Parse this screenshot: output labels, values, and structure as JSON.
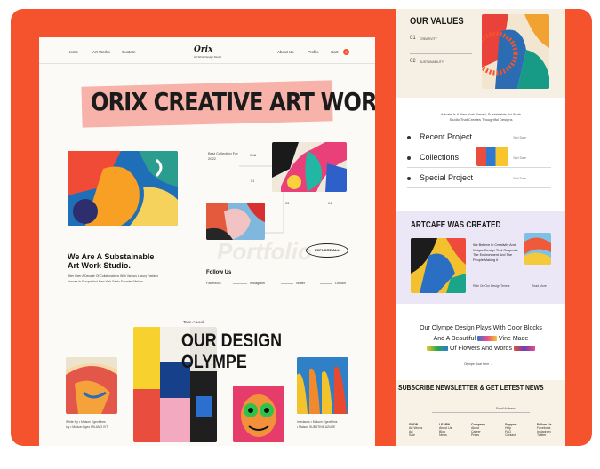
{
  "left_page": {
    "nav": {
      "left_links": [
        "Home",
        "Art Works",
        "Custom"
      ],
      "logo": "Orix",
      "logo_sub": "Art Work Design Studio",
      "right_links": [
        "About Us",
        "Profile",
        "Cart"
      ],
      "cart_count": "0"
    },
    "hero_title": "ORIX CREATIVE ART WORK",
    "collection": {
      "label": "Best Collection For 2022",
      "item_tags": [
        "Wall",
        "01",
        "03",
        "04"
      ]
    },
    "studio": {
      "heading_line1": "We Are A Substainable",
      "heading_line2": "Art Work Studio.",
      "body_line1": "After Over A Decade Of Collaborations With Various Luxury Fashion",
      "body_line2": "Houses In Europe And New York Santo Founded Melocu"
    },
    "explore_button": "EXPLORE ALL",
    "watermark": "Portfolio",
    "follow": {
      "title": "Follow Us",
      "links": [
        "Facebook",
        "Instagram",
        "Twitter",
        "Linkdin"
      ]
    },
    "design": {
      "take_a_look": "Take A Look",
      "title_line1": "OUR DESIGN",
      "title_line2": "OLYMPE",
      "caption_left_line1": "White Ivy • Maison Egeoffilms",
      "caption_left_line2": "Ivy • Maison Egeo MILANO IVT",
      "caption_right_line1": "Interlaces • Maison Egeoffilms",
      "caption_right_line2": "• Maison SUBSTINE AZURE"
    }
  },
  "right_page": {
    "values": {
      "title": "OUR VALUES",
      "items": [
        {
          "num": "01",
          "label": "CREATIVITY"
        },
        {
          "num": "02",
          "label": "SUSTAINABILITY"
        }
      ]
    },
    "intro_line1": "Artcafe Is A New York Based, Sustainable Art Work",
    "intro_line2": "Studio That Creates Thoughtful Designs",
    "list": [
      {
        "label": "Recent Project",
        "meta": "Sort Date"
      },
      {
        "label": "Collections",
        "meta": "Sort Date"
      },
      {
        "label": "Special Project",
        "meta": "Sort Date"
      }
    ],
    "artcafe": {
      "title": "ARTCAFE WAS CREATED",
      "text_line1": "We Believe In Creativity And",
      "text_line2": "Unique Design That Respects",
      "text_line3": "The Environment And The",
      "text_line4": "People Making It",
      "caption": "Ride On Our Design Tenets",
      "link": "Read More"
    },
    "olympe": {
      "line1": "Our Olympe Design Plays With Color Blocks",
      "line2a": "And A Beautiful",
      "line2b": "Vine Made",
      "line3": "Of Flowers And Words",
      "button": "Olympe Goal Here →"
    },
    "newsletter": {
      "title": "SUBSCRIBE NEWSLETTER & GET LETEST NEWS",
      "email_label": "Email Address",
      "footer_cols": [
        {
          "title": "SHOP",
          "items": [
            "Art Works",
            "Art",
            "Sale"
          ]
        },
        {
          "title": "LEARN",
          "items": [
            "About Us",
            "Blog",
            "News"
          ]
        },
        {
          "title": "Company",
          "items": [
            "About",
            "Career",
            "Press"
          ]
        },
        {
          "title": "Support",
          "items": [
            "Help",
            "FAQ",
            "Contact"
          ]
        },
        {
          "title": "Follow Us",
          "items": [
            "Facebook",
            "Instagram",
            "Twitter"
          ]
        }
      ]
    }
  },
  "colors": {
    "brand_orange": "#f4532e",
    "banner_pink": "#f7b2a9",
    "lavender": "#ece7f6",
    "cream": "#f6f0e4"
  }
}
